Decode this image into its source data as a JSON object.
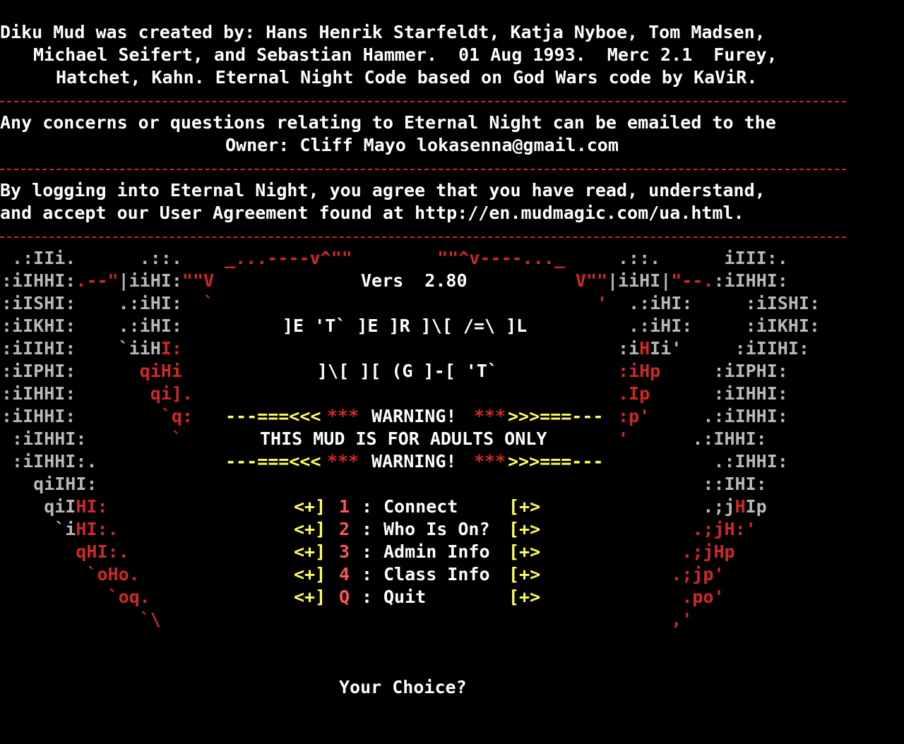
{
  "colors": {
    "background": "#000000",
    "text": "#ffffff",
    "art_grey": "#b8b8b8",
    "art_red": "#d02828",
    "menu_yellow": "#ffff55",
    "menu_key_red": "#ff5555"
  },
  "credits": [
    "Diku Mud was created by: Hans Henrik Starfeldt, Katja Nyboe, Tom Madsen,",
    "Michael Seifert, and Sebastian Hammer.  01 Aug 1993.  Merc 2.1  Furey,",
    "Hatchet, Kahn. Eternal Night Code based on God Wars code by KaViR."
  ],
  "contact": [
    "Any concerns or questions relating to Eternal Night can be emailed to the",
    "Owner: Cliff Mayo lokasenna@gmail.com"
  ],
  "agreement": [
    "By logging into Eternal Night, you agree that you have read, understand,",
    "and accept our User Agreement found at http://en.mudmagic.com/ua.html."
  ],
  "version": "Vers  2.80",
  "logo_line1": "]E 'T` ]E ]R ]\\[ /=\\ ]L",
  "logo_line2": "]\\[ ][ (G ]-[ 'T`",
  "warning": {
    "prefix": "---===<<<",
    "stars_left": "***",
    "label": " WARNING! ",
    "stars_right": "***",
    "suffix": ">>>===---",
    "message": "THIS MUD IS FOR ADULTS ONLY"
  },
  "menu": [
    {
      "key": "1",
      "label": "Connect"
    },
    {
      "key": "2",
      "label": "Who Is On?"
    },
    {
      "key": "3",
      "label": "Admin Info"
    },
    {
      "key": "4",
      "label": "Class Info"
    },
    {
      "key": "Q",
      "label": "Quit"
    }
  ],
  "menu_bullet_left": "<+]",
  "menu_bullet_right": "[+>",
  "prompt": "Your Choice?",
  "art": [
    {
      "segs": [
        [
          " .:IIi.      .::.    ",
          "g"
        ],
        [
          "_...----v^\"\"",
          "r"
        ],
        [
          "        ",
          "w"
        ],
        [
          "\"\"^v----..._",
          "r"
        ],
        [
          "     .::.      ",
          "g"
        ],
        [
          "iIII:.",
          "g"
        ]
      ]
    },
    {
      "segs": [
        [
          ":iIHHI:",
          "g"
        ],
        [
          ".--\"",
          "r"
        ],
        [
          "|iiHI:",
          "g"
        ],
        [
          "\"\"V",
          "r"
        ],
        [
          "                                  ",
          "w"
        ],
        [
          "V\"\"",
          "r"
        ],
        [
          "|iiHI|",
          "g"
        ],
        [
          "\"--.",
          "r"
        ],
        [
          ":iIHHI:",
          "g"
        ]
      ]
    },
    {
      "segs": [
        [
          ":iISHI:    .:iHI:  ",
          "g"
        ],
        [
          "`",
          "r"
        ],
        [
          "                                    ",
          "w"
        ],
        [
          "'",
          "r"
        ],
        [
          "  .:iHI:     :iISHI:",
          "g"
        ]
      ]
    },
    {
      "segs": [
        [
          ":iIKHI:    .:iHI:",
          "g"
        ],
        [
          "                                          ",
          "w"
        ],
        [
          ".:iHI:     :iIKHI:",
          "g"
        ]
      ]
    },
    {
      "segs": [
        [
          ":iIIHI:    `iiH",
          "g"
        ],
        [
          "I:",
          "r"
        ],
        [
          "                                         ",
          "w"
        ],
        [
          ":i",
          "g"
        ],
        [
          "H",
          "r"
        ],
        [
          "Ii'     :iIIHI:",
          "g"
        ]
      ]
    },
    {
      "segs": [
        [
          ":iIPHI:      ",
          "g"
        ],
        [
          "qiHi",
          "r"
        ],
        [
          "                                         ",
          "w"
        ],
        [
          ":iHp",
          "r"
        ],
        [
          "     :iIPHI:",
          "g"
        ]
      ]
    },
    {
      "segs": [
        [
          ":iIHHI:       ",
          "g"
        ],
        [
          "qi].",
          "r"
        ],
        [
          "                                        ",
          "w"
        ],
        [
          ".Ip",
          "r"
        ],
        [
          "      :iIHHI:",
          "g"
        ]
      ]
    },
    {
      "segs": [
        [
          ":iIHHI:        ",
          "g"
        ],
        [
          "`q:",
          "r"
        ],
        [
          "                                        ",
          "w"
        ],
        [
          ":p'",
          "r"
        ],
        [
          "     .:iIHHI:",
          "g"
        ]
      ]
    },
    {
      "segs": [
        [
          " :iIHHI:        ",
          "g"
        ],
        [
          "`",
          "r"
        ],
        [
          "                                         ",
          "w"
        ],
        [
          "'",
          "r"
        ],
        [
          "      .:IHHI:",
          "g"
        ]
      ]
    },
    {
      "segs": [
        [
          " :iIHHI:.",
          "g"
        ],
        [
          "                                                          ",
          "w"
        ],
        [
          ".:IHHI:",
          "g"
        ]
      ]
    },
    {
      "segs": [
        [
          "   qiIHI:",
          "g"
        ],
        [
          "                                                         ",
          "w"
        ],
        [
          "::IHI:",
          "g"
        ]
      ]
    },
    {
      "segs": [
        [
          "    qiI",
          "g"
        ],
        [
          "HI:",
          "r"
        ],
        [
          "                                                        ",
          "w"
        ],
        [
          ".;j",
          "g"
        ],
        [
          "H",
          "r"
        ],
        [
          "Ip",
          "g"
        ]
      ]
    },
    {
      "segs": [
        [
          "     `i",
          "g"
        ],
        [
          "HI:.",
          "r"
        ],
        [
          "                                                      ",
          "w"
        ],
        [
          ".;jH:'",
          "r"
        ]
      ]
    },
    {
      "segs": [
        [
          "       ",
          "w"
        ],
        [
          "qHI:.",
          "r"
        ],
        [
          "                                                    ",
          "w"
        ],
        [
          ".;jHp",
          "r"
        ]
      ]
    },
    {
      "segs": [
        [
          "        ",
          "w"
        ],
        [
          "`oHo.",
          "r"
        ],
        [
          "                                                  ",
          "w"
        ],
        [
          ".;jp'",
          "r"
        ]
      ]
    },
    {
      "segs": [
        [
          "          ",
          "w"
        ],
        [
          "`oq.",
          "r"
        ],
        [
          "                                                  ",
          "w"
        ],
        [
          ".po'",
          "r"
        ]
      ]
    },
    {
      "segs": [
        [
          "             ",
          "w"
        ],
        [
          "`\\",
          "r"
        ],
        [
          "                                                ",
          "w"
        ],
        [
          ",'",
          "r"
        ]
      ]
    }
  ]
}
